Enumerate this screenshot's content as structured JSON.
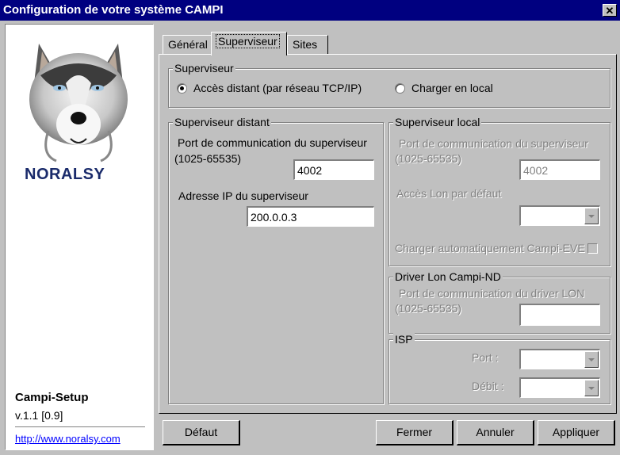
{
  "window": {
    "title": "Configuration de votre système CAMPI"
  },
  "sidebar": {
    "logo_text": "NORALSY",
    "app_name": "Campi-Setup",
    "version": "v.1.1 [0.9]",
    "website": "http://www.noralsy.com"
  },
  "tabs": [
    {
      "label": "Général",
      "active": false
    },
    {
      "label": "Superviseur",
      "active": true
    },
    {
      "label": "Sites",
      "active": false
    }
  ],
  "superviseur": {
    "group_label": "Superviseur",
    "radio_remote": "Accès distant (par réseau TCP/IP)",
    "radio_local": "Charger en local",
    "selected": "remote"
  },
  "distant": {
    "group_label": "Superviseur distant",
    "port_label": "Port de communication du superviseur",
    "port_range": "(1025-65535)",
    "port_value": "4002",
    "ip_label": "Adresse IP du superviseur",
    "ip_value": "200.0.0.3"
  },
  "local": {
    "group_label": "Superviseur local",
    "port_label": "Port de communication du superviseur",
    "port_range": "(1025-65535)",
    "port_value": "4002",
    "lon_label": "Accès Lon par défaut",
    "lon_value": "",
    "autoload_label": "Charger automatiquement Campi-EVE"
  },
  "driver": {
    "group_label": "Driver Lon Campi-ND",
    "port_label": "Port de communication du driver LON",
    "port_range": "(1025-65535)",
    "port_value": ""
  },
  "isp": {
    "group_label": "ISP",
    "port_label": "Port :",
    "rate_label": "Débit :"
  },
  "buttons": {
    "default": "Défaut",
    "close": "Fermer",
    "cancel": "Annuler",
    "apply": "Appliquer"
  },
  "colors": {
    "titlebar": "#000080",
    "face": "#c0c0c0",
    "link": "#0000ff"
  }
}
